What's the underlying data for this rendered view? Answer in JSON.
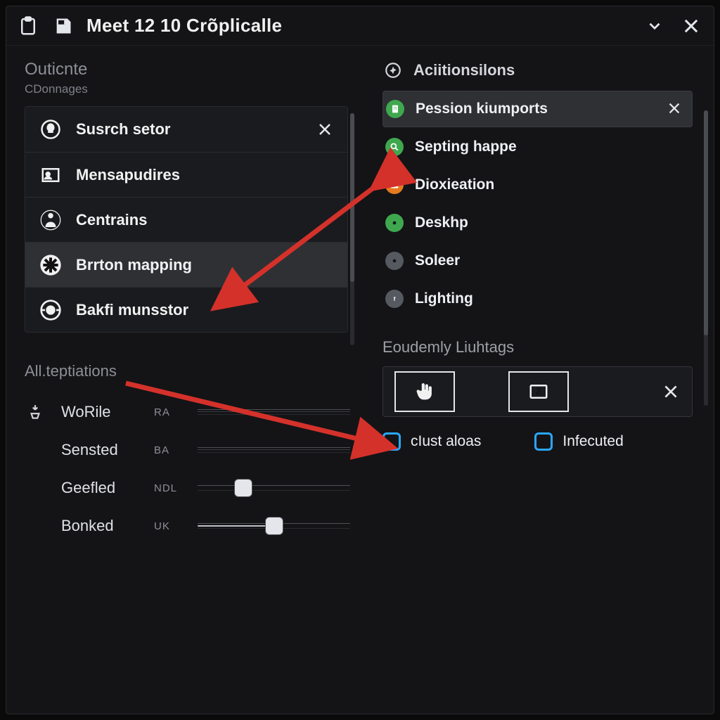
{
  "window": {
    "title": "Meet 12 10 Crõplicalle"
  },
  "left": {
    "title": "Outicnte",
    "subtitle": "CDonnages",
    "items": [
      {
        "label": "Susrch setor",
        "icon": "bulb-icon",
        "closable": true
      },
      {
        "label": "Mensapudires",
        "icon": "user-card-icon"
      },
      {
        "label": "Centrains",
        "icon": "person-icon"
      },
      {
        "label": "Brrton mapping",
        "icon": "asterisk-icon",
        "selected": true
      },
      {
        "label": "Bakfi munsstor",
        "icon": "dial-icon"
      }
    ],
    "sliders_title": "All.teptiations",
    "sliders": [
      {
        "label": "WoRile",
        "tag": "RA",
        "kind": "double",
        "value": 0
      },
      {
        "label": "Sensted",
        "tag": "BA",
        "kind": "double",
        "value": 0
      },
      {
        "label": "Geefled",
        "tag": "NDL",
        "kind": "knob",
        "value": 0.3
      },
      {
        "label": "Bonked",
        "tag": "UK",
        "kind": "bar",
        "value": 0.5
      }
    ]
  },
  "right": {
    "header": "Aciitionsilons",
    "options": [
      {
        "label": "Pession kiumports",
        "color": "#3fa84f",
        "glyph": "doc",
        "selected": true,
        "closable": true
      },
      {
        "label": "Septing happe",
        "color": "#3fa84f",
        "glyph": "search"
      },
      {
        "label": "Dioxieation",
        "color": "#e57a1f",
        "glyph": "camera"
      },
      {
        "label": "Deskhp",
        "color": "#3fa84f",
        "glyph": "ring"
      },
      {
        "label": "Soleer",
        "color": "#555a60",
        "glyph": "ring"
      },
      {
        "label": "Lighting",
        "color": "#555a60",
        "glyph": "f"
      }
    ],
    "lower_title": "Eoudemly Liuhtags",
    "checks": [
      {
        "label": "cIust aloas"
      },
      {
        "label": "Infecuted"
      }
    ]
  },
  "colors": {
    "accent": "#2aa7ff",
    "bg": "#141416",
    "panel": "#1a1b1e",
    "selected": "#2e3034"
  }
}
